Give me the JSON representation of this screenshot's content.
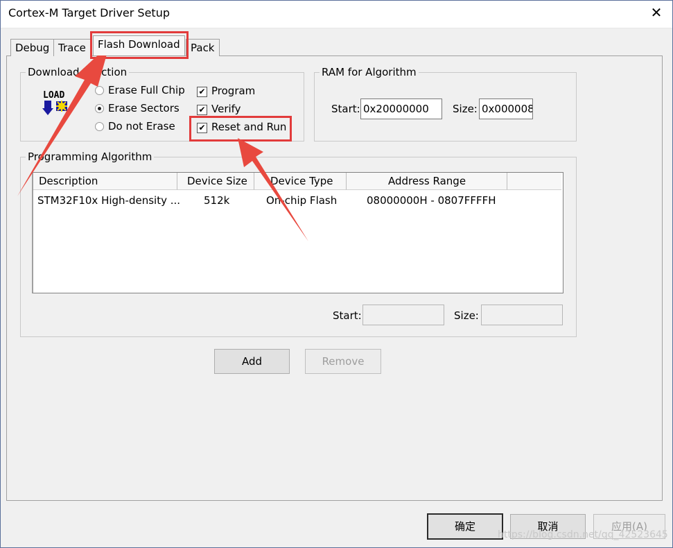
{
  "window": {
    "title": "Cortex-M Target Driver Setup",
    "close_glyph": "✕"
  },
  "tabs": [
    {
      "label": "Debug"
    },
    {
      "label": "Trace"
    },
    {
      "label": "Flash Download"
    },
    {
      "label": "Pack"
    }
  ],
  "download_function": {
    "legend": "Download Function",
    "icon_text": "LOAD",
    "erase_options": [
      {
        "label": "Erase Full Chip",
        "selected": false
      },
      {
        "label": "Erase Sectors",
        "selected": true
      },
      {
        "label": "Do not Erase",
        "selected": false
      }
    ],
    "checks": [
      {
        "label": "Program",
        "checked": true
      },
      {
        "label": "Verify",
        "checked": true
      },
      {
        "label": "Reset and Run",
        "checked": true
      }
    ]
  },
  "ram": {
    "legend": "RAM for Algorithm",
    "start_label": "Start:",
    "start_value": "0x20000000",
    "size_label": "Size:",
    "size_value": "0x000008"
  },
  "programming": {
    "legend": "Programming Algorithm",
    "columns": [
      "Description",
      "Device Size",
      "Device Type",
      "Address Range"
    ],
    "rows": [
      {
        "description": "STM32F10x High-density ...",
        "size": "512k",
        "type": "On-chip Flash",
        "range": "08000000H - 0807FFFFH"
      }
    ],
    "start_label": "Start:",
    "start_value": "",
    "size_label": "Size:",
    "size_value": ""
  },
  "buttons": {
    "add": "Add",
    "remove": "Remove"
  },
  "footer": {
    "ok": "确定",
    "cancel": "取消",
    "apply": "应用(A)"
  },
  "watermark": "https://blog.csdn.net/qq_42523645",
  "colors": {
    "highlight": "#e23b3b"
  }
}
